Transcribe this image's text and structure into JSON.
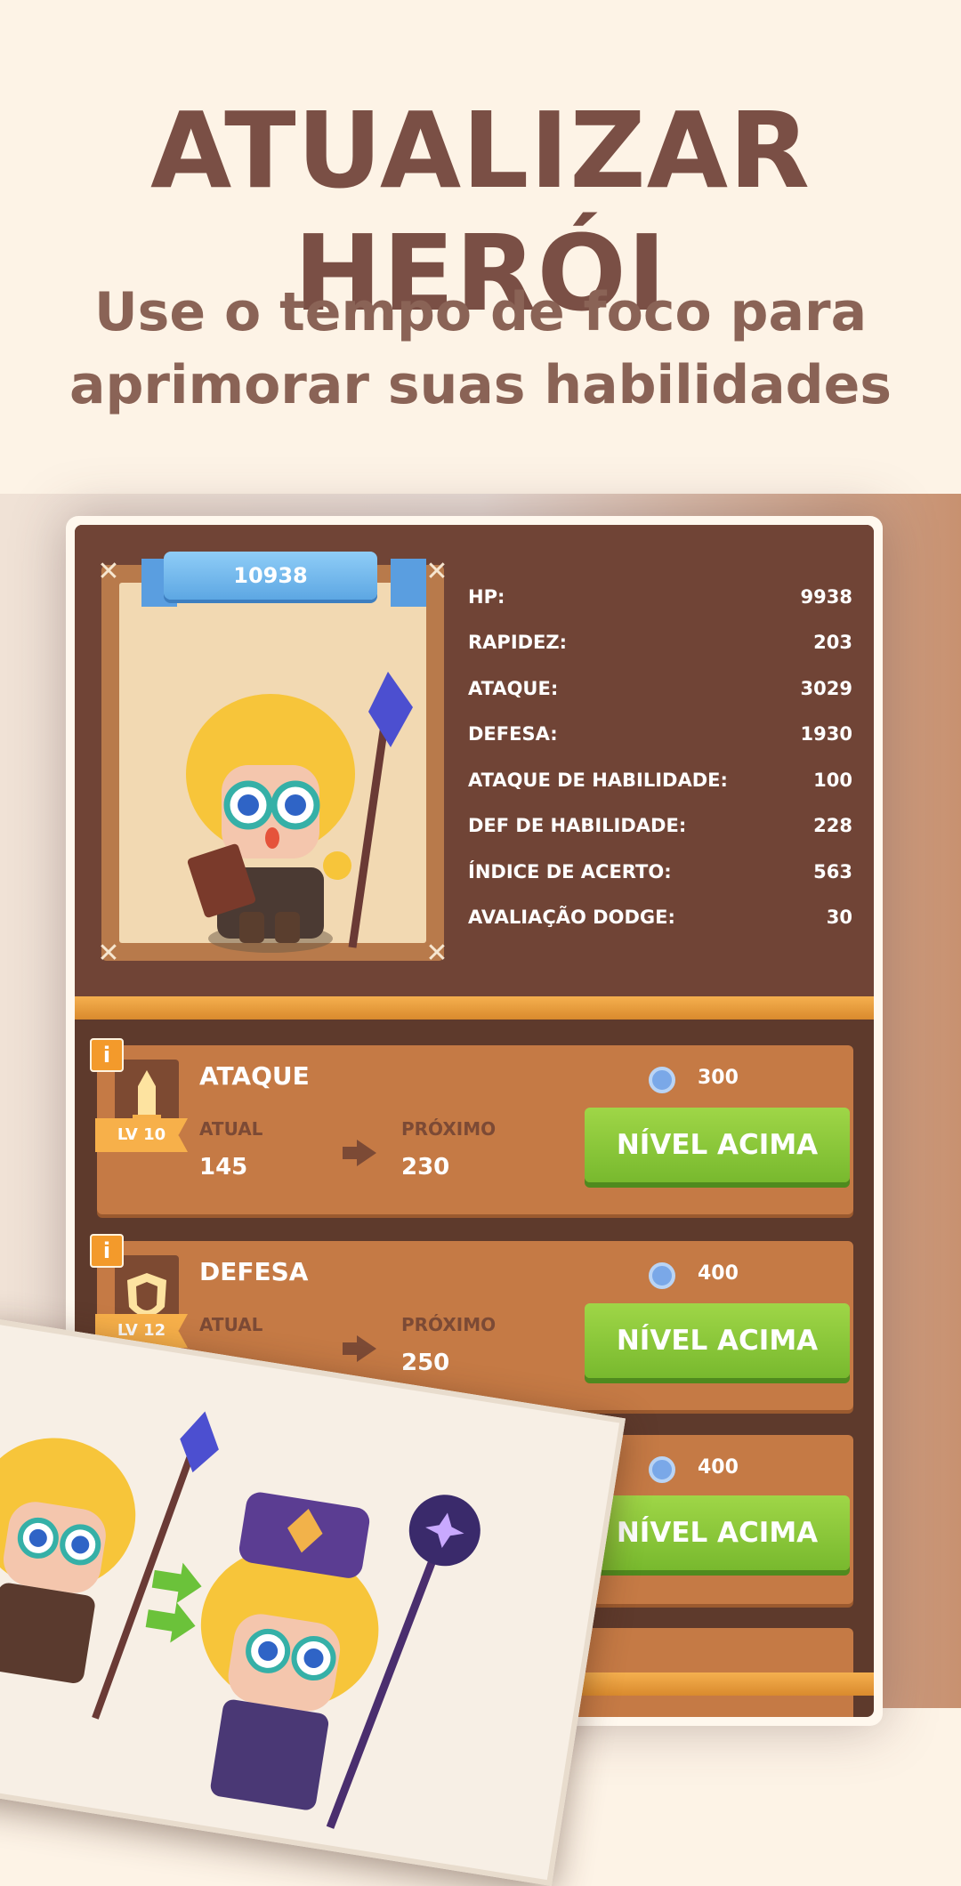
{
  "header": {
    "title": "ATUALIZAR HERÓI",
    "subtitle_line1": "Use o tempo de foco para",
    "subtitle_line2": "aprimorar suas habilidades"
  },
  "hero": {
    "power": "10938",
    "stats": [
      {
        "label": "HP:",
        "value": "9938"
      },
      {
        "label": "RAPIDEZ:",
        "value": "203"
      },
      {
        "label": "ATAQUE:",
        "value": "3029"
      },
      {
        "label": "DEFESA:",
        "value": "1930"
      },
      {
        "label": "ATAQUE DE HABILIDADE:",
        "value": "100"
      },
      {
        "label": "DEF DE HABILIDADE:",
        "value": "228"
      },
      {
        "label": "ÍNDICE DE ACERTO:",
        "value": "563"
      },
      {
        "label": "AVALIAÇÃO DODGE:",
        "value": "30"
      }
    ]
  },
  "upgrades": [
    {
      "info": "i",
      "title": "ATAQUE",
      "level": "LV 10",
      "current_label": "ATUAL",
      "current_value": "145",
      "next_label": "PRÓXIMO",
      "next_value": "230",
      "cost": "300",
      "button": "NÍVEL ACIMA"
    },
    {
      "info": "i",
      "title": "DEFESA",
      "level": "LV 12",
      "current_label": "ATUAL",
      "current_value": "",
      "next_label": "PRÓXIMO",
      "next_value": "250",
      "cost": "400",
      "button": "NÍVEL ACIMA"
    },
    {
      "cost": "400",
      "button": "NÍVEL ACIMA"
    }
  ],
  "colors": {
    "accent": "#7a4f45",
    "button": "#86c338",
    "panel": "#704436"
  }
}
